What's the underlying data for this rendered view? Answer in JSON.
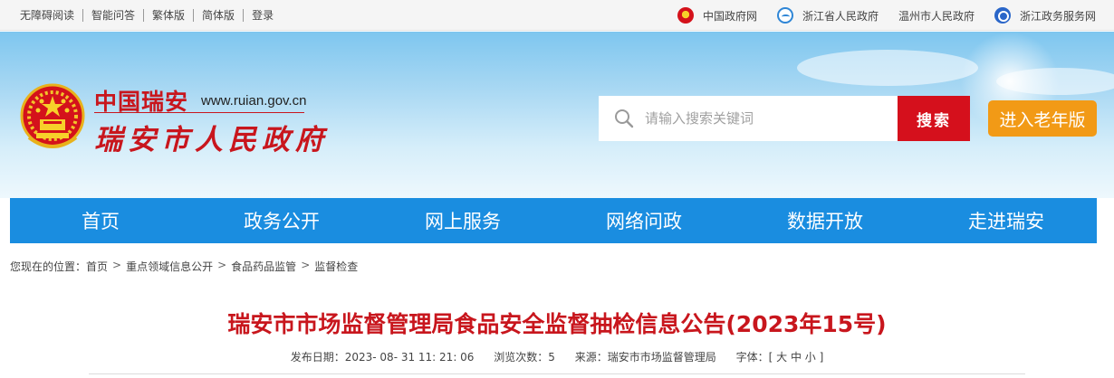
{
  "topbar": {
    "links": [
      "无障碍阅读",
      "智能问答",
      "繁体版",
      "简体版",
      "登录"
    ],
    "gov_links": [
      {
        "label": "中国政府网",
        "icon": "national-emblem-icon"
      },
      {
        "label": "浙江省人民政府",
        "icon": "zhejiang-gov-icon"
      },
      {
        "label": "温州市人民政府",
        "icon": ""
      },
      {
        "label": "浙江政务服务网",
        "icon": "zj-service-icon"
      }
    ]
  },
  "header": {
    "logo_line1": "中国瑞安",
    "logo_url": "www.ruian.gov.cn",
    "logo_line2": "瑞安市人民政府",
    "search_placeholder": "请输入搜索关键词",
    "search_button": "搜索",
    "elder_button": "进入老年版"
  },
  "nav": [
    "首页",
    "政务公开",
    "网上服务",
    "网络问政",
    "数据开放",
    "走进瑞安"
  ],
  "breadcrumb": {
    "prefix": "您现在的位置：",
    "items": [
      "首页",
      "重点领域信息公开",
      "食品药品监管",
      "监督检查"
    ],
    "separator": ">"
  },
  "article": {
    "title": "瑞安市市场监督管理局食品安全监督抽检信息公告(2023年15号)",
    "date_label": "发布日期：",
    "date_value": "2023- 08- 31 11: 21: 06",
    "views_label": "浏览次数：",
    "views_value": "5",
    "source_label": "来源：",
    "source_value": "瑞安市市场监督管理局",
    "font_label": "字体：",
    "font_value": "[ 大 中 小 ]"
  },
  "colors": {
    "nav_blue": "#1a8de0",
    "brand_red": "#c8161d",
    "search_red": "#d5101c",
    "elder_orange": "#f29a16"
  }
}
